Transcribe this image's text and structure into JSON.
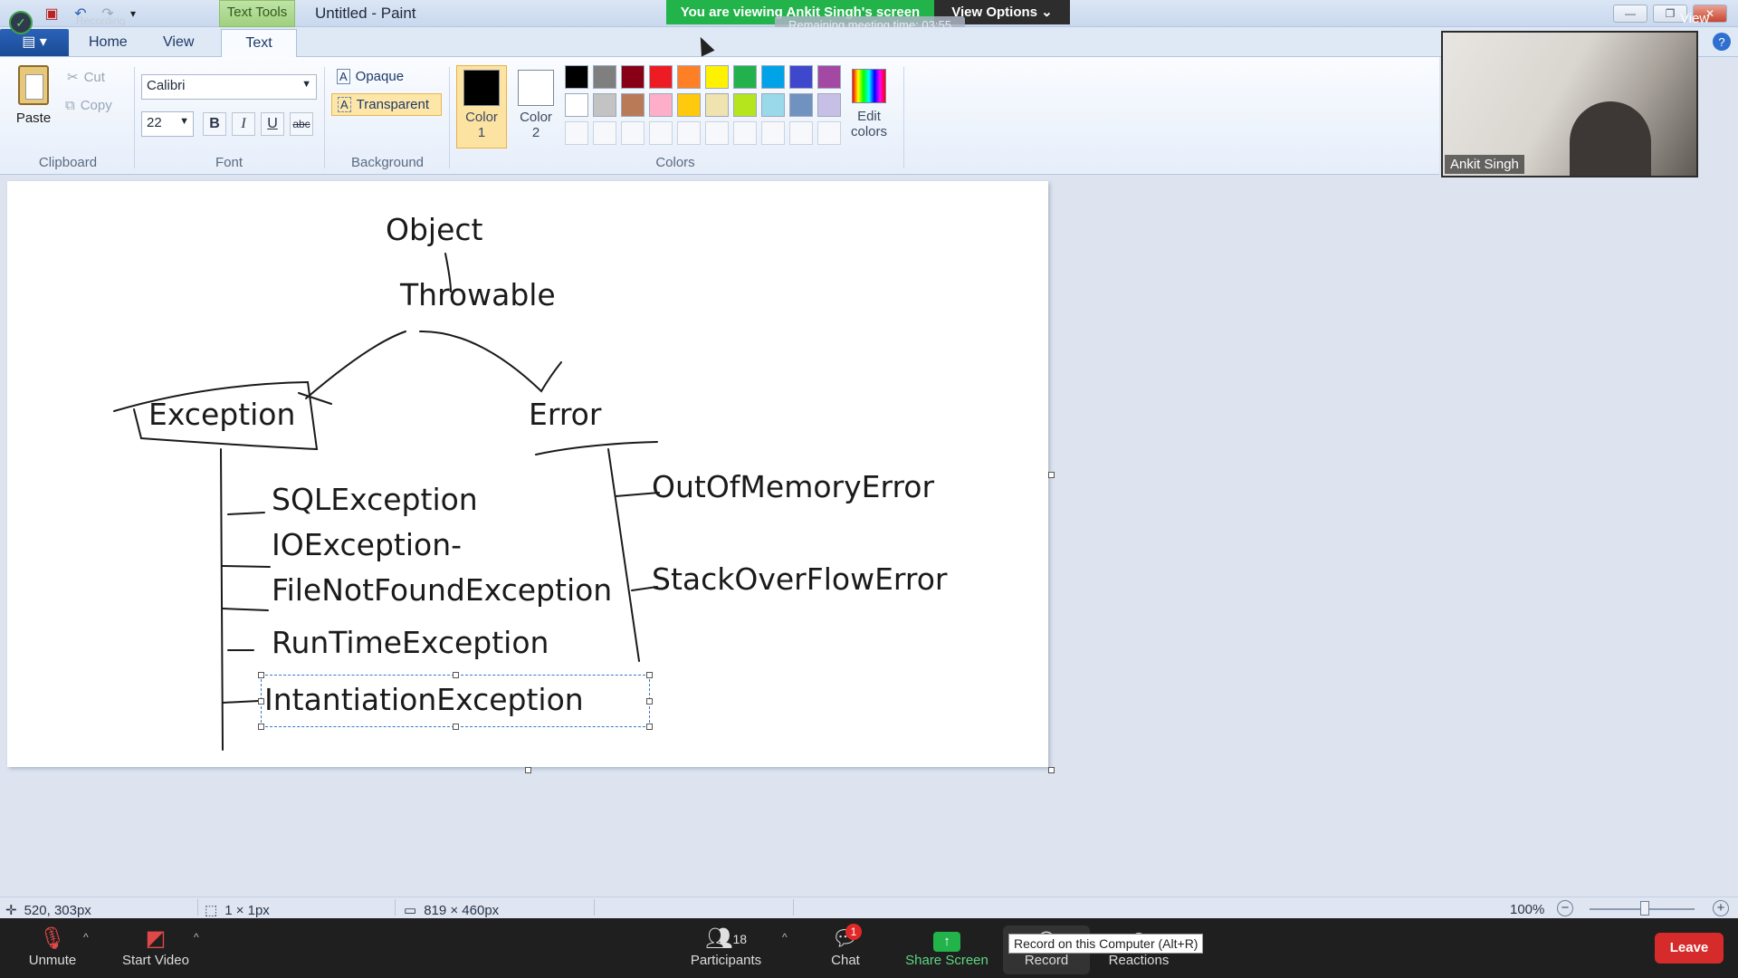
{
  "titlebar": {
    "recording_label": "Recording",
    "text_tools_tab": "Text Tools",
    "window_title": "Untitled - Paint",
    "zoom_banner": "You are viewing Ankit Singh's screen",
    "view_options": "View Options",
    "remaining_time": "Remaining meeting time: 03:55",
    "view_label": "View"
  },
  "tabs": {
    "home": "Home",
    "view": "View",
    "text": "Text"
  },
  "clipboard": {
    "paste": "Paste",
    "cut": "Cut",
    "copy": "Copy",
    "label": "Clipboard"
  },
  "font": {
    "family": "Calibri",
    "size": "22",
    "bold": "B",
    "italic": "I",
    "underline": "U",
    "strikethrough": "abc",
    "label": "Font"
  },
  "background": {
    "opaque": "Opaque",
    "transparent": "Transparent",
    "label": "Background"
  },
  "colors": {
    "color1": "Color 1",
    "color2": "Color 2",
    "edit": "Edit colors",
    "label": "Colors",
    "color1_value": "#000000",
    "color2_value": "#ffffff",
    "palette_row1": [
      "#000000",
      "#7f7f7f",
      "#880015",
      "#ed1c24",
      "#ff7f27",
      "#fff200",
      "#22b14c",
      "#00a2e8",
      "#3f48cc",
      "#a349a4"
    ],
    "palette_row2": [
      "#ffffff",
      "#c3c3c3",
      "#b97a57",
      "#ffaec9",
      "#ffc90e",
      "#efe4b0",
      "#b5e61d",
      "#99d9ea",
      "#7092be",
      "#c8bfe7"
    ]
  },
  "canvas": {
    "words": {
      "object": "Object",
      "throwable": "Throwable",
      "exception": "Exception",
      "error": "Error",
      "sql": "SQLException",
      "io": "IOException-",
      "fnf": "FileNotFoundException",
      "runtime": "RunTimeException",
      "instantiation": "IntantiationException",
      "oom": "OutOfMemoryError",
      "so": "StackOverFlowError"
    }
  },
  "webcam": {
    "name": "Ankit Singh"
  },
  "statusbar": {
    "cursor": "520, 303px",
    "selection": "1 × 1px",
    "size": "819 × 460px",
    "zoom": "100%"
  },
  "zoombar": {
    "unmute": "Unmute",
    "start_video": "Start Video",
    "participants": "Participants",
    "participants_count": "18",
    "chat": "Chat",
    "chat_badge": "1",
    "share_screen": "Share Screen",
    "record": "Record",
    "reactions": "Reactions",
    "record_tooltip": "Record on this Computer (Alt+R)",
    "leave": "Leave"
  }
}
